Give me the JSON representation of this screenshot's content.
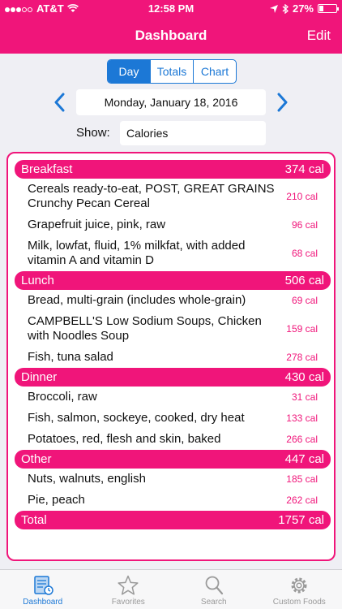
{
  "status": {
    "carrier": "AT&T",
    "time": "12:58 PM",
    "battery": "27%",
    "battery_level": 0.27
  },
  "nav": {
    "title": "Dashboard",
    "edit": "Edit"
  },
  "segments": {
    "day": "Day",
    "totals": "Totals",
    "chart": "Chart",
    "selected": "Day"
  },
  "date": "Monday, January 18, 2016",
  "show": {
    "label": "Show:",
    "value": "Calories"
  },
  "sections": [
    {
      "name": "Breakfast",
      "total": "374 cal",
      "items": [
        {
          "name": "Cereals ready-to-eat, POST, GREAT GRAINS Crunchy Pecan Cereal",
          "cal": "210 cal"
        },
        {
          "name": "Grapefruit juice, pink, raw",
          "cal": "96 cal"
        },
        {
          "name": "Milk, lowfat, fluid, 1% milkfat, with added vitamin A and vitamin D",
          "cal": "68 cal"
        }
      ]
    },
    {
      "name": "Lunch",
      "total": "506 cal",
      "items": [
        {
          "name": "Bread, multi-grain (includes whole-grain)",
          "cal": "69 cal"
        },
        {
          "name": "CAMPBELL'S Low Sodium Soups, Chicken with Noodles Soup",
          "cal": "159 cal"
        },
        {
          "name": "Fish, tuna salad",
          "cal": "278 cal"
        }
      ]
    },
    {
      "name": "Dinner",
      "total": "430 cal",
      "items": [
        {
          "name": "Broccoli, raw",
          "cal": "31 cal"
        },
        {
          "name": "Fish, salmon, sockeye, cooked, dry heat",
          "cal": "133 cal"
        },
        {
          "name": "Potatoes, red, flesh and skin, baked",
          "cal": "266 cal"
        }
      ]
    },
    {
      "name": "Other",
      "total": "447 cal",
      "items": [
        {
          "name": "Nuts, walnuts, english",
          "cal": "185 cal"
        },
        {
          "name": "Pie, peach",
          "cal": "262 cal"
        }
      ]
    }
  ],
  "total": {
    "label": "Total",
    "value": "1757 cal"
  },
  "tabs": [
    {
      "label": "Dashboard",
      "icon": "dashboard-icon"
    },
    {
      "label": "Favorites",
      "icon": "star-icon"
    },
    {
      "label": "Search",
      "icon": "search-icon"
    },
    {
      "label": "Custom Foods",
      "icon": "gear-icon"
    }
  ],
  "colors": {
    "accent": "#f0157a",
    "tint": "#1c78d6",
    "background": "#efeff4"
  }
}
